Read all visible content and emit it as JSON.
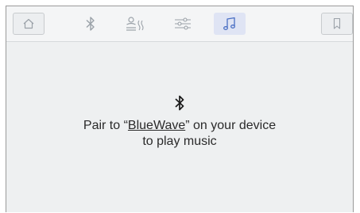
{
  "toolbar": {
    "buttons": [
      {
        "icon": "home-icon",
        "state": "boxed"
      },
      {
        "icon": "bluetooth-icon",
        "state": "normal"
      },
      {
        "icon": "heat-steam-icon",
        "state": "normal"
      },
      {
        "icon": "sliders-icon",
        "state": "normal"
      },
      {
        "icon": "music-note-icon",
        "state": "active"
      },
      {
        "icon": "bookmark-icon",
        "state": "boxed"
      }
    ],
    "icon_color": "#9aa1a8",
    "active_icon_color": "#4a6fc4",
    "active_bg": "#dfe4f4"
  },
  "pairing": {
    "icon": "bluetooth-icon",
    "prefix": "Pair to “",
    "device_name": "BlueWave",
    "suffix": "” on your device",
    "line2": "to play music"
  }
}
